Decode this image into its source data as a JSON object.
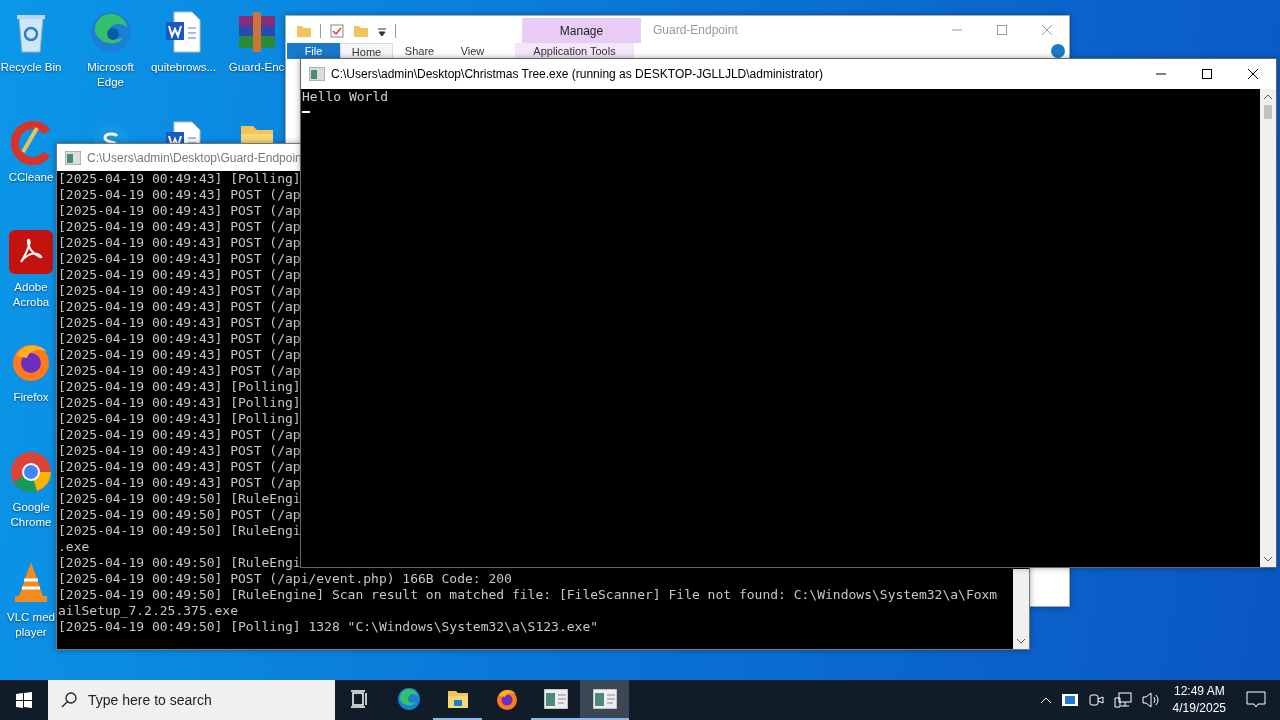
{
  "desktop": {
    "icon_columns": [
      [
        {
          "kind": "recycle",
          "label": [
            "Recycle Bin"
          ]
        },
        {
          "kind": "ccleaner",
          "label": [
            "CCleane"
          ]
        },
        {
          "kind": "acrobat",
          "label": [
            "Adobe",
            "Acroba"
          ]
        },
        {
          "kind": "firefox",
          "label": [
            "Firefox"
          ]
        },
        {
          "kind": "chrome",
          "label": [
            "Google",
            "Chrome"
          ]
        },
        {
          "kind": "vlc",
          "label": [
            "VLC med",
            "player"
          ]
        }
      ],
      [
        {
          "kind": "edge",
          "label": [
            "Microsoft",
            "Edge"
          ]
        },
        {
          "kind": "skype"
        }
      ],
      [
        {
          "kind": "word",
          "label": [
            "quitebrows..."
          ]
        },
        {
          "kind": "word"
        }
      ],
      [
        {
          "kind": "winrar",
          "label": [
            "Guard-Enc"
          ]
        },
        {
          "kind": "folder"
        }
      ]
    ]
  },
  "explorer_window": {
    "title": "Guard-Endpoint",
    "context_tab": "Manage",
    "ribbon_tabs": [
      {
        "label": "File",
        "kind": "file",
        "selected": false
      },
      {
        "label": "Home",
        "kind": "tab",
        "selected": true
      },
      {
        "label": "Share",
        "kind": "tab",
        "selected": false
      },
      {
        "label": "View",
        "kind": "tab",
        "selected": false
      }
    ],
    "context_group": "Application Tools"
  },
  "guard_console": {
    "title": "C:\\Users\\admin\\Desktop\\Guard-Endpoin",
    "lines": [
      "[2025-04-19 00:49:43] [Polling]",
      "[2025-04-19 00:49:43] POST (/ap",
      "[2025-04-19 00:49:43] POST (/ap",
      "[2025-04-19 00:49:43] POST (/ap",
      "[2025-04-19 00:49:43] POST (/ap",
      "[2025-04-19 00:49:43] POST (/ap",
      "[2025-04-19 00:49:43] POST (/ap",
      "[2025-04-19 00:49:43] POST (/ap",
      "[2025-04-19 00:49:43] POST (/ap",
      "[2025-04-19 00:49:43] POST (/ap",
      "[2025-04-19 00:49:43] POST (/ap",
      "[2025-04-19 00:49:43] POST (/ap",
      "[2025-04-19 00:49:43] POST (/ap",
      "[2025-04-19 00:49:43] [Polling]",
      "[2025-04-19 00:49:43] [Polling]",
      "[2025-04-19 00:49:43] [Polling]",
      "[2025-04-19 00:49:43] POST (/ap",
      "[2025-04-19 00:49:43] POST (/ap",
      "[2025-04-19 00:49:43] POST (/ap",
      "[2025-04-19 00:49:43] POST (/ap",
      "[2025-04-19 00:49:50] [RuleEngi",
      "[2025-04-19 00:49:50] POST (/ap",
      "[2025-04-19 00:49:50] [RuleEngi",
      ".exe",
      "[2025-04-19 00:49:50] [RuleEngi",
      "[2025-04-19 00:49:50] POST (/api/event.php) 166B Code: 200",
      "[2025-04-19 00:49:50] [RuleEngine] Scan result on matched file: [FileScanner] File not found: C:\\Windows\\System32\\a\\Foxm",
      "ailSetup_7.2.25.375.exe",
      "[2025-04-19 00:49:50] [Polling] 1328 \"C:\\Windows\\System32\\a\\S123.exe\""
    ]
  },
  "tree_console": {
    "title": "C:\\Users\\admin\\Desktop\\Christmas Tree.exe (running as DESKTOP-JGLLJLD\\administrator)",
    "lines": [
      "Hello World"
    ]
  },
  "taskbar": {
    "search_placeholder": "Type here to search",
    "apps": [
      {
        "kind": "taskview",
        "running": false,
        "selected": false
      },
      {
        "kind": "edge",
        "running": false,
        "selected": false
      },
      {
        "kind": "explorer",
        "running": true,
        "selected": false
      },
      {
        "kind": "firefox",
        "running": false,
        "selected": false
      },
      {
        "kind": "console",
        "running": true,
        "selected": false
      },
      {
        "kind": "console",
        "running": true,
        "selected": true
      }
    ],
    "time": "12:49 AM",
    "date": "4/19/2025"
  }
}
